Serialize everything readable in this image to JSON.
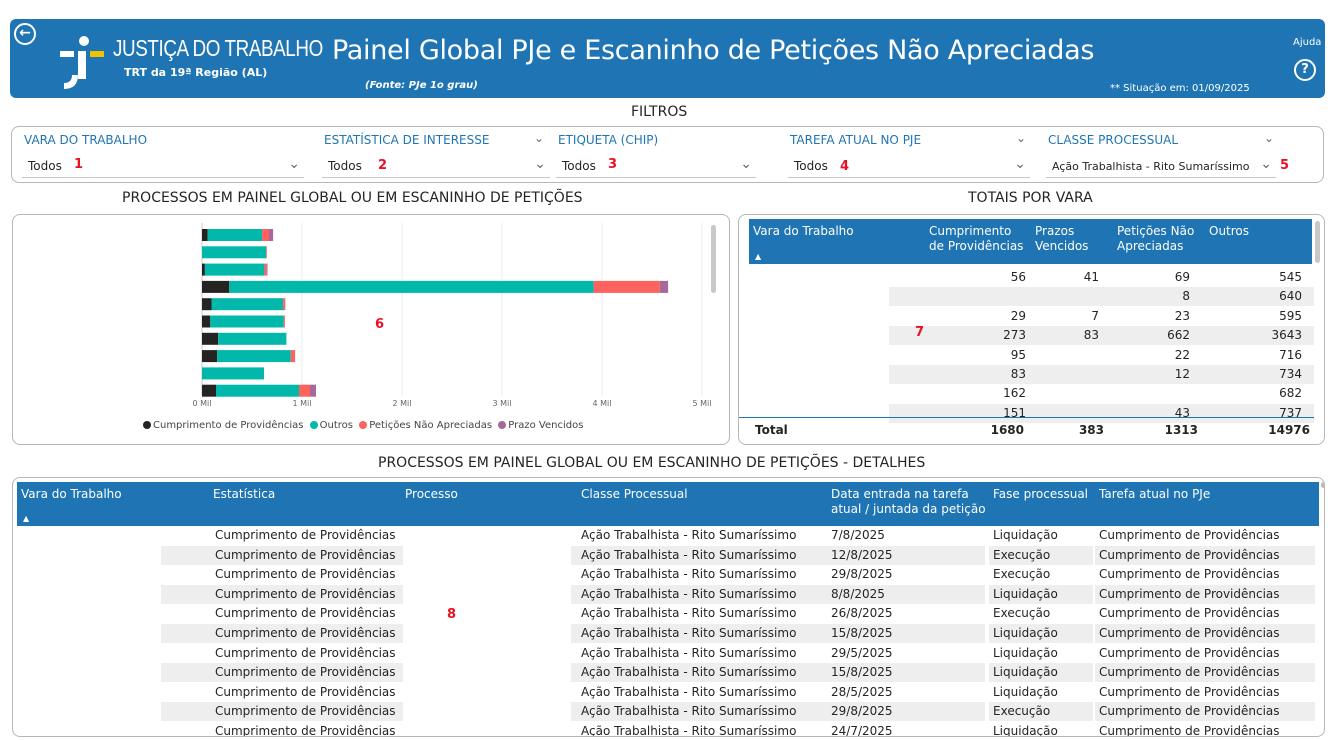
{
  "header": {
    "back_icon": "back-arrow-icon",
    "logo_title": "JUSTIÇA DO TRABALHO",
    "logo_subtitle": "TRT da 19ª Região (AL)",
    "title": "Painel Global PJe e Escaninho de Petições Não Apreciadas",
    "source": "(Fonte: PJe 1o grau)",
    "situacao": "** Situação em: 01/09/2025",
    "ajuda_label": "Ajuda",
    "ajuda_icon": "help-icon",
    "background_color": "#1f75b4"
  },
  "filters": {
    "title": "FILTROS",
    "items": [
      {
        "label": "VARA DO TRABALHO",
        "value": "Todos",
        "marker": "1"
      },
      {
        "label": "ESTATÍSTICA DE INTERESSE",
        "value": "Todos",
        "marker": "2"
      },
      {
        "label": "ETIQUETA (CHIP)",
        "value": "Todos",
        "marker": "3"
      },
      {
        "label": "TAREFA ATUAL NO PJE",
        "value": "Todos",
        "marker": "4"
      },
      {
        "label": "CLASSE PROCESSUAL",
        "value": "Ação Trabalhista - Rito Sumaríssimo",
        "marker": "5"
      }
    ]
  },
  "chart_section": {
    "title": "PROCESSOS EM PAINEL GLOBAL OU EM ESCANINHO DE PETIÇÕES",
    "marker": "6"
  },
  "chart_data": {
    "type": "bar",
    "orientation": "horizontal",
    "stacked": true,
    "categories": [
      "",
      "",
      "",
      "",
      "",
      "",
      "",
      "",
      "",
      ""
    ],
    "series": [
      {
        "name": "Cumprimento de Providências",
        "color": "#252423",
        "values": [
          56,
          0,
          29,
          273,
          95,
          83,
          162,
          151,
          0,
          140
        ]
      },
      {
        "name": "Outros",
        "color": "#01b8aa",
        "values": [
          545,
          640,
          595,
          3643,
          716,
          734,
          682,
          737,
          620,
          830
        ]
      },
      {
        "name": "Petições Não Apreciadas",
        "color": "#fd625e",
        "values": [
          69,
          8,
          23,
          662,
          22,
          12,
          0,
          43,
          0,
          110
        ]
      },
      {
        "name": "Prazo Vencidos",
        "color": "#a66999",
        "values": [
          41,
          0,
          7,
          83,
          0,
          0,
          0,
          0,
          0,
          60
        ]
      }
    ],
    "xlim": [
      0,
      5000
    ],
    "x_ticks": [
      "0 Mil",
      "1 Mil",
      "2 Mil",
      "3 Mil",
      "4 Mil",
      "5 Mil"
    ],
    "legend_position": "bottom",
    "grid": true
  },
  "totals": {
    "title": "TOTAIS POR VARA",
    "marker": "7",
    "columns": [
      "Vara do Trabalho",
      "Cumprimento de Providências",
      "Prazos Vencidos",
      "Petições Não Apreciadas",
      "Outros"
    ],
    "col_cp_line1": "Cumprimento",
    "col_cp_line2": "de Providências",
    "col_pv_line1": "Prazos",
    "col_pv_line2": "Vencidos",
    "col_pna_line1": "Petições Não",
    "col_pna_line2": "Apreciadas",
    "rows": [
      {
        "vara": "",
        "cp": "56",
        "pv": "41",
        "pna": "69",
        "outros": "545"
      },
      {
        "vara": "",
        "cp": "",
        "pv": "",
        "pna": "8",
        "outros": "640"
      },
      {
        "vara": "",
        "cp": "29",
        "pv": "7",
        "pna": "23",
        "outros": "595"
      },
      {
        "vara": "",
        "cp": "273",
        "pv": "83",
        "pna": "662",
        "outros": "3643"
      },
      {
        "vara": "",
        "cp": "95",
        "pv": "",
        "pna": "22",
        "outros": "716"
      },
      {
        "vara": "",
        "cp": "83",
        "pv": "",
        "pna": "12",
        "outros": "734"
      },
      {
        "vara": "",
        "cp": "162",
        "pv": "",
        "pna": "",
        "outros": "682"
      },
      {
        "vara": "",
        "cp": "151",
        "pv": "",
        "pna": "43",
        "outros": "737"
      }
    ],
    "total": {
      "label": "Total",
      "cp": "1680",
      "pv": "383",
      "pna": "1313",
      "outros": "14976"
    }
  },
  "details": {
    "title": "PROCESSOS EM PAINEL GLOBAL OU EM ESCANINHO DE PETIÇÕES - DETALHES",
    "marker": "8",
    "columns": [
      "Vara do Trabalho",
      "Estatística",
      "Processo",
      "Classe Processual",
      "Data entrada na tarefa atual / juntada da petição",
      "Fase processual",
      "Tarefa atual no PJe"
    ],
    "col_data_line1": "Data entrada na tarefa",
    "col_data_line2": "atual / juntada da petição",
    "rows": [
      {
        "estatistica": "Cumprimento de Providências",
        "classe": "Ação Trabalhista - Rito Sumaríssimo",
        "data": "7/8/2025",
        "fase": "Liquidação",
        "tarefa": "Cumprimento de Providências"
      },
      {
        "estatistica": "Cumprimento de Providências",
        "classe": "Ação Trabalhista - Rito Sumaríssimo",
        "data": "12/8/2025",
        "fase": "Execução",
        "tarefa": "Cumprimento de Providências"
      },
      {
        "estatistica": "Cumprimento de Providências",
        "classe": "Ação Trabalhista - Rito Sumaríssimo",
        "data": "29/8/2025",
        "fase": "Execução",
        "tarefa": "Cumprimento de Providências"
      },
      {
        "estatistica": "Cumprimento de Providências",
        "classe": "Ação Trabalhista - Rito Sumaríssimo",
        "data": "8/8/2025",
        "fase": "Liquidação",
        "tarefa": "Cumprimento de Providências"
      },
      {
        "estatistica": "Cumprimento de Providências",
        "classe": "Ação Trabalhista - Rito Sumaríssimo",
        "data": "26/8/2025",
        "fase": "Execução",
        "tarefa": "Cumprimento de Providências"
      },
      {
        "estatistica": "Cumprimento de Providências",
        "classe": "Ação Trabalhista - Rito Sumaríssimo",
        "data": "15/8/2025",
        "fase": "Liquidação",
        "tarefa": "Cumprimento de Providências"
      },
      {
        "estatistica": "Cumprimento de Providências",
        "classe": "Ação Trabalhista - Rito Sumaríssimo",
        "data": "29/5/2025",
        "fase": "Liquidação",
        "tarefa": "Cumprimento de Providências"
      },
      {
        "estatistica": "Cumprimento de Providências",
        "classe": "Ação Trabalhista - Rito Sumaríssimo",
        "data": "15/8/2025",
        "fase": "Liquidação",
        "tarefa": "Cumprimento de Providências"
      },
      {
        "estatistica": "Cumprimento de Providências",
        "classe": "Ação Trabalhista - Rito Sumaríssimo",
        "data": "28/5/2025",
        "fase": "Liquidação",
        "tarefa": "Cumprimento de Providências"
      },
      {
        "estatistica": "Cumprimento de Providências",
        "classe": "Ação Trabalhista - Rito Sumaríssimo",
        "data": "29/8/2025",
        "fase": "Execução",
        "tarefa": "Cumprimento de Providências"
      },
      {
        "estatistica": "Cumprimento de Providências",
        "classe": "Ação Trabalhista - Rito Sumaríssimo",
        "data": "24/7/2025",
        "fase": "Liquidação",
        "tarefa": "Cumprimento de Providências"
      }
    ]
  },
  "colors": {
    "accent": "#1f75b4",
    "marker": "#e81123",
    "row_alt": "#eeeeee"
  }
}
